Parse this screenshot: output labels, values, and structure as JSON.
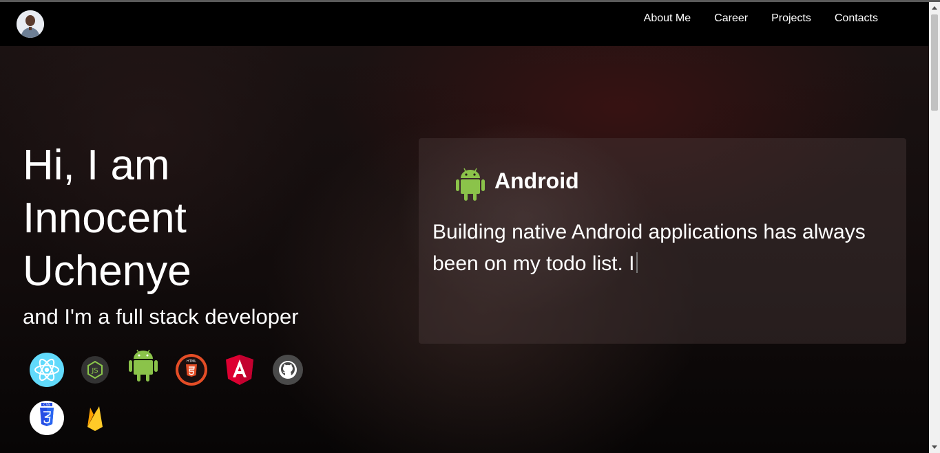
{
  "nav": {
    "avatar_icon": "profile-photo",
    "links": [
      "About Me",
      "Career",
      "Projects",
      "Contacts"
    ]
  },
  "hero": {
    "greeting": "Hi, I am",
    "first_name": "Innocent",
    "last_name": "Uchenye",
    "subtitle": "and I'm a full stack developer"
  },
  "tech_icons": [
    "react-icon",
    "nodejs-icon",
    "android-icon",
    "html5-icon",
    "angular-icon",
    "github-icon",
    "css3-icon",
    "firebase-icon"
  ],
  "card": {
    "icon": "android-icon",
    "title": "Android",
    "text": "Building native Android applications has always been on my todo list. I"
  },
  "colors": {
    "android_green": "#8bc34a",
    "react_blue": "#61dafb",
    "html_orange": "#e44d26",
    "angular_red": "#dd0031",
    "css_blue": "#264de4",
    "firebase_yellow": "#ffca28"
  }
}
